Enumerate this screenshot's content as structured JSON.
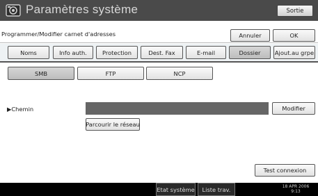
{
  "header": {
    "title": "Paramètres système",
    "exit_label": "Sortie",
    "icon": "settings-icon"
  },
  "breadcrumb": "Programmer/Modifier carnet d'adresses",
  "actions": {
    "cancel_label": "Annuler",
    "ok_label": "OK"
  },
  "tabs": [
    {
      "label": "Noms"
    },
    {
      "label": "Info auth."
    },
    {
      "label": "Protection"
    },
    {
      "label": "Dest. Fax"
    },
    {
      "label": "E-mail"
    },
    {
      "label": "Dossier",
      "selected": true
    },
    {
      "label": "Ajout.au grpe"
    }
  ],
  "protocols": [
    {
      "label": "SMB",
      "selected": true
    },
    {
      "label": "FTP"
    },
    {
      "label": "NCP"
    }
  ],
  "path": {
    "label": "▶Chemin",
    "value": "",
    "modify_label": "Modifier",
    "browse_label": "Parcourir le réseau"
  },
  "test_connection_label": "Test connexion",
  "statusbar": {
    "system_status_label": "Etat système",
    "job_list_label": "Liste trav.",
    "date": "18 APR  2006",
    "time": "9:13"
  },
  "colors": {
    "title_bar": "#4a4a4a",
    "selected_button": "#c8c8c8",
    "path_field": "#666666"
  }
}
